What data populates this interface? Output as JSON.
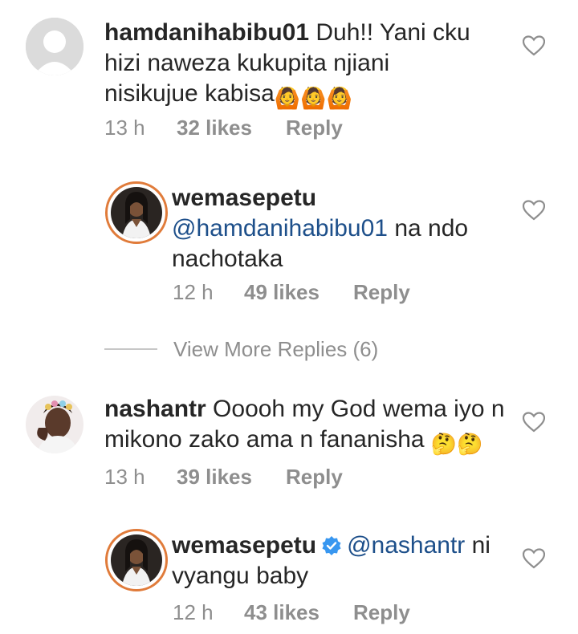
{
  "comments": [
    {
      "username": "hamdanihabibu01",
      "text": "Duh!! Yani cku hizi naweza kukupita njiani nisikujue kabisa",
      "emoji": "🙆🙆🙆",
      "time": "13 h",
      "likes": "32 likes",
      "reply": "Reply",
      "avatar": "default-avatar-icon"
    },
    {
      "username": "wemasepetu",
      "mention": "@hamdanihabibu01",
      "text": "na ndo nachotaka",
      "time": "12 h",
      "likes": "49 likes",
      "reply": "Reply"
    },
    {
      "username": "nashantr",
      "text": "Ooooh my God wema iyo n mikono zako ama n fananisha",
      "emoji": "🤔🤔",
      "time": "13 h",
      "likes": "39 likes",
      "reply": "Reply"
    },
    {
      "username": "wemasepetu",
      "verified": true,
      "mention": "@nashantr",
      "text": "ni vyangu baby",
      "time": "12 h",
      "likes": "43 likes",
      "reply": "Reply"
    }
  ],
  "view_more": "View More Replies (6)",
  "colors": {
    "text": "#262626",
    "muted": "#8e8e8e",
    "mention": "#1d4f8a",
    "story_ring": "#e07b3a",
    "verified": "#3897f0"
  }
}
